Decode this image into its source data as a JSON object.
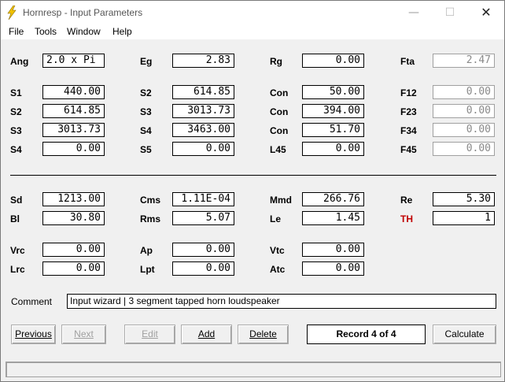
{
  "window": {
    "title": "Hornresp - Input Parameters",
    "minimize": "—",
    "maximize": "☐",
    "close": "✕"
  },
  "menu": [
    "File",
    "Tools",
    "Window",
    "Help"
  ],
  "rows1": [
    {
      "l1": "Ang",
      "v1": "2.0 x Pi",
      "l2": "Eg",
      "v2": "2.83",
      "l3": "Rg",
      "v3": "0.00",
      "l4": "Fta",
      "v4": "2.47"
    }
  ],
  "rows2": [
    {
      "l1": "S1",
      "v1": "440.00",
      "l2": "S2",
      "v2": "614.85",
      "l3": "Con",
      "v3": "50.00",
      "l4": "F12",
      "v4": "0.00"
    },
    {
      "l1": "S2",
      "v1": "614.85",
      "l2": "S3",
      "v2": "3013.73",
      "l3": "Con",
      "v3": "394.00",
      "l4": "F23",
      "v4": "0.00"
    },
    {
      "l1": "S3",
      "v1": "3013.73",
      "l2": "S4",
      "v2": "3463.00",
      "l3": "Con",
      "v3": "51.70",
      "l4": "F34",
      "v4": "0.00"
    },
    {
      "l1": "S4",
      "v1": "0.00",
      "l2": "S5",
      "v2": "0.00",
      "l3": "L45",
      "v3": "0.00",
      "l4": "F45",
      "v4": "0.00"
    }
  ],
  "rows3": [
    {
      "l1": "Sd",
      "v1": "1213.00",
      "l2": "Cms",
      "v2": "1.11E-04",
      "l3": "Mmd",
      "v3": "266.76",
      "l4": "Re",
      "v4": "5.30"
    },
    {
      "l1": "Bl",
      "v1": "30.80",
      "l2": "Rms",
      "v2": "5.07",
      "l3": "Le",
      "v3": "1.45",
      "l4": "TH",
      "v4": "1"
    }
  ],
  "rows4": [
    {
      "l1": "Vrc",
      "v1": "0.00",
      "l2": "Ap",
      "v2": "0.00",
      "l3": "Vtc",
      "v3": "0.00"
    },
    {
      "l1": "Lrc",
      "v1": "0.00",
      "l2": "Lpt",
      "v2": "0.00",
      "l3": "Atc",
      "v3": "0.00"
    }
  ],
  "comment": {
    "label": "Comment",
    "value": "Input wizard | 3 segment tapped horn loudspeaker"
  },
  "buttons": {
    "previous": "Previous",
    "next": "Next",
    "edit": "Edit",
    "add": "Add",
    "delete": "Delete",
    "calculate": "Calculate"
  },
  "record": "Record 4 of 4",
  "colors": {
    "accent_red": "#c00000",
    "icon_yellow": "#f2c200"
  },
  "icons": {
    "app": "lightning-bolt-icon"
  }
}
